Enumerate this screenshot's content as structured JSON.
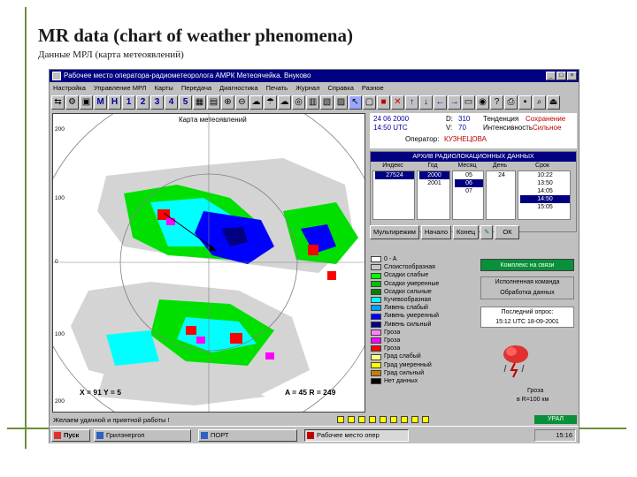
{
  "slide": {
    "title": "MR data (chart of weather phenomena)",
    "subtitle": "Данные МРЛ (карта метеоявлений)"
  },
  "window": {
    "title": "Рабочее место оператора-радиометеоролога АМРК Метеоячейка. Внуково"
  },
  "menu": [
    "Настройка",
    "Управление МРЛ",
    "Карты",
    "Передача",
    "Диагностика",
    "Печать",
    "Журнал",
    "Справка",
    "Разное"
  ],
  "toolbar": {
    "letters": [
      "М",
      "Н"
    ],
    "numbers": [
      "1",
      "2",
      "3",
      "4",
      "5"
    ]
  },
  "map": {
    "label": "Карта метеоявлений",
    "y_ticks": [
      "200",
      "100",
      "0",
      "100",
      "200"
    ],
    "cursor_x": "X = 91 Y = 5",
    "cursor_az": "A = 45 R = 249"
  },
  "info": {
    "date": "24 06 2000",
    "time": "14:50 UTC",
    "d_label": "D:",
    "d_value": "310",
    "v_label": "V:",
    "v_value": "70",
    "trend_label": "Тенденция",
    "trend_value": "Сохранение",
    "intensity_label": "Интенсивность",
    "intensity_value": "Сильное",
    "operator_label": "Оператор:",
    "operator_name": "КУЗНЕЦОВА"
  },
  "archive": {
    "title": "АРХИВ РАДИОЛОКАЦИОННЫХ ДАННЫХ",
    "headers": [
      "Индекс",
      "Год",
      "Месяц",
      "День",
      "Срок"
    ],
    "index": [
      "27524"
    ],
    "year": [
      "2000",
      "2001"
    ],
    "month": [
      "05",
      "06",
      "07"
    ],
    "day": [
      "24"
    ],
    "time": [
      "10:22",
      "13:50",
      "14:05",
      "14:50",
      "15:05"
    ],
    "buttons": [
      "Мультирежим",
      "Начало",
      "Конец",
      "ОК"
    ]
  },
  "legend": [
    {
      "label": "0 - A",
      "color": "#ffffff"
    },
    {
      "label": "Слоистообразная",
      "color": "#c8c8c8"
    },
    {
      "label": "Осадки слабые",
      "color": "#00ff00"
    },
    {
      "label": "Осадки умеренные",
      "color": "#00c000"
    },
    {
      "label": "Осадки сильные",
      "color": "#008000"
    },
    {
      "label": "Кучевообразная",
      "color": "#00ffff"
    },
    {
      "label": "Ливень слабый",
      "color": "#00a0ff"
    },
    {
      "label": "Ливень умеренный",
      "color": "#0000ff"
    },
    {
      "label": "Ливень сильный",
      "color": "#000080"
    },
    {
      "label": "Гроза",
      "color": "#ff80ff"
    },
    {
      "label": "Гроза",
      "color": "#ff00ff"
    },
    {
      "label": "Гроза",
      "color": "#ff0000"
    },
    {
      "label": "Град слабый",
      "color": "#ffff80"
    },
    {
      "label": "Град умеренный",
      "color": "#ffff00"
    },
    {
      "label": "Град сильный",
      "color": "#c08000"
    },
    {
      "label": "Нет данных",
      "color": "#000000"
    }
  ],
  "status_panel": {
    "link_status": "Комплекс на связи",
    "last_command_label": "Исполненная команда",
    "last_command_value": "Обработка данных",
    "last_survey_label": "Последний опрос:",
    "last_survey_value": "15:12 UTC 18-09-2001",
    "storm_label": "Гроза",
    "storm_range": "в R=100 км"
  },
  "statusbar": {
    "message": "Желаем удачной и приятной работы !",
    "ural_label": "УРАЛ"
  },
  "taskbar": {
    "start": "Пуск",
    "tasks": [
      "Грилэнергоп",
      "ПОРТ",
      "Рабочее место опер"
    ],
    "clock": "15:16"
  },
  "accent_colors": {
    "titlebar": "#000080",
    "ok_green": "#0a8f3a",
    "slide_accent": "#6b8f3a"
  }
}
